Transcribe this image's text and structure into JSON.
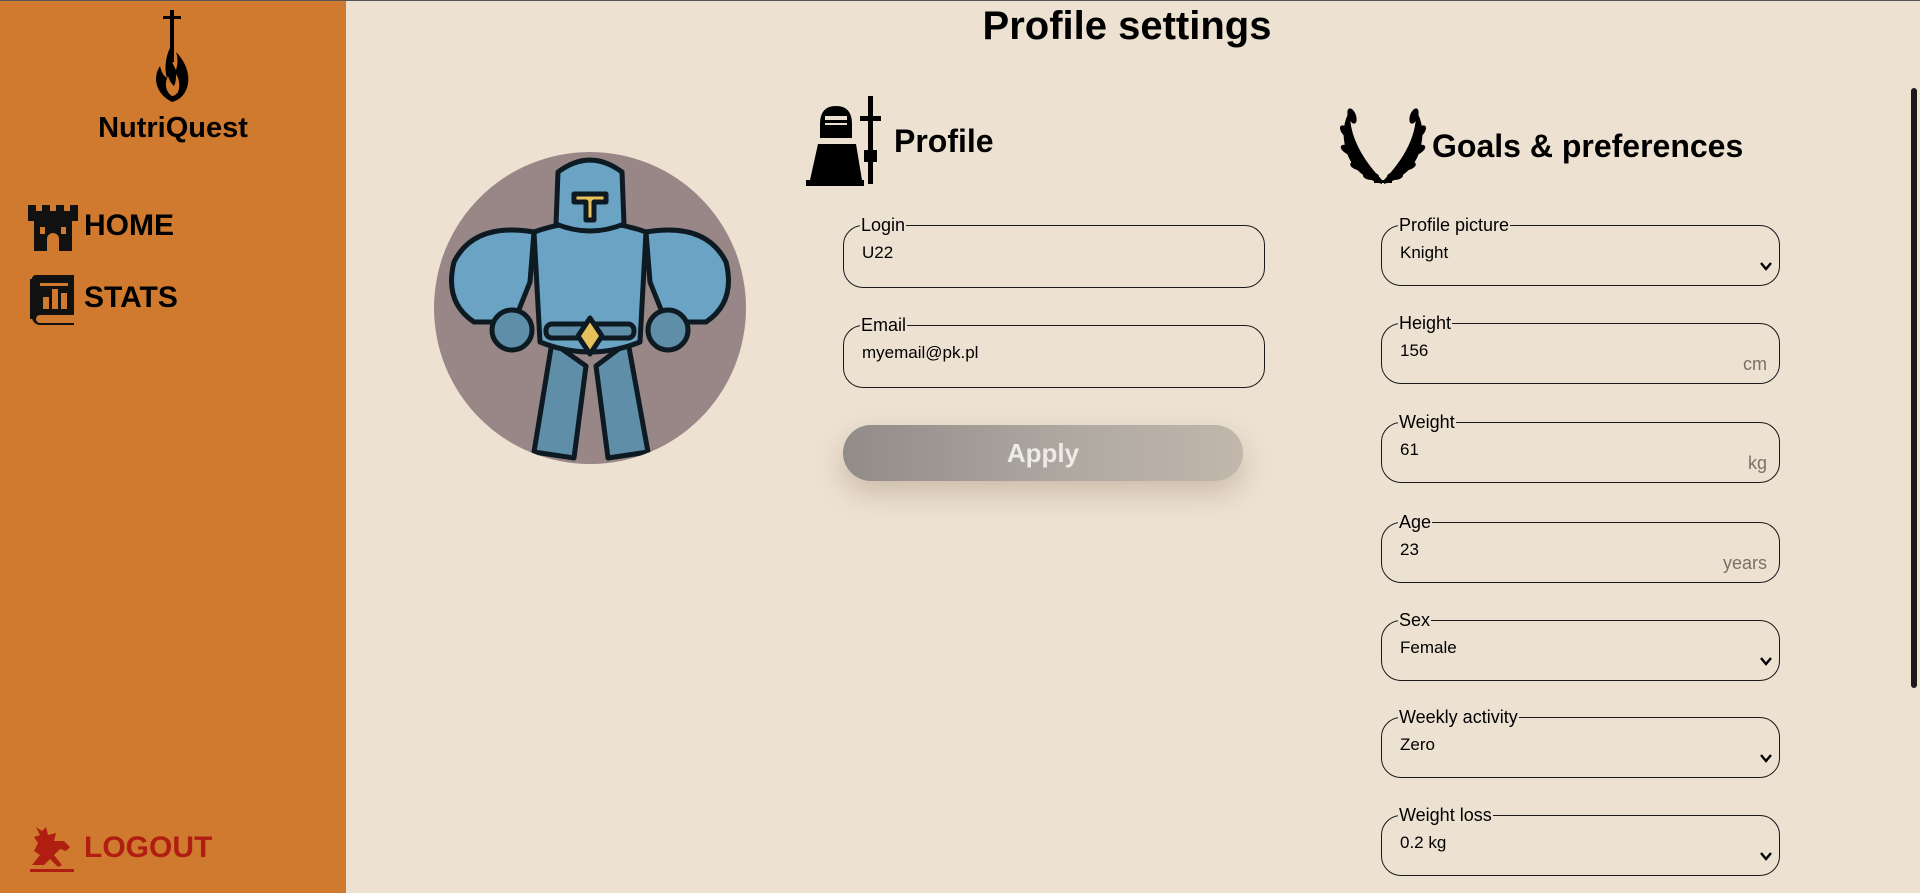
{
  "sidebar": {
    "brand": "NutriQuest",
    "logo_icon": "sword-flame-icon",
    "items": [
      {
        "label": "HOME",
        "icon": "castle-icon"
      },
      {
        "label": "STATS",
        "icon": "stats-book-icon"
      }
    ],
    "logout": {
      "label": "LOGOUT",
      "icon": "knight-horse-icon",
      "color": "#b01e12"
    },
    "background": "#d07a2f"
  },
  "main": {
    "title": "Profile settings",
    "background": "#ede1d2",
    "avatar": {
      "image": "muscular-knight-avatar"
    },
    "profile": {
      "heading": "Profile",
      "icon": "knight-helmet-sword-icon",
      "login": {
        "label": "Login",
        "value": "U22"
      },
      "email": {
        "label": "Email",
        "value": "myemail@pk.pl"
      },
      "apply_label": "Apply"
    },
    "goals": {
      "heading": "Goals & preferences",
      "icon": "laurel-wreath-icon",
      "profile_picture": {
        "label": "Profile picture",
        "value": "Knight"
      },
      "height": {
        "label": "Height",
        "value": "156",
        "unit": "cm"
      },
      "weight": {
        "label": "Weight",
        "value": "61",
        "unit": "kg"
      },
      "age": {
        "label": "Age",
        "value": "23",
        "unit": "years"
      },
      "sex": {
        "label": "Sex",
        "value": "Female"
      },
      "weekly_activity": {
        "label": "Weekly activity",
        "value": "Zero"
      },
      "weight_loss": {
        "label": "Weight loss",
        "value": "0.2 kg"
      }
    }
  }
}
